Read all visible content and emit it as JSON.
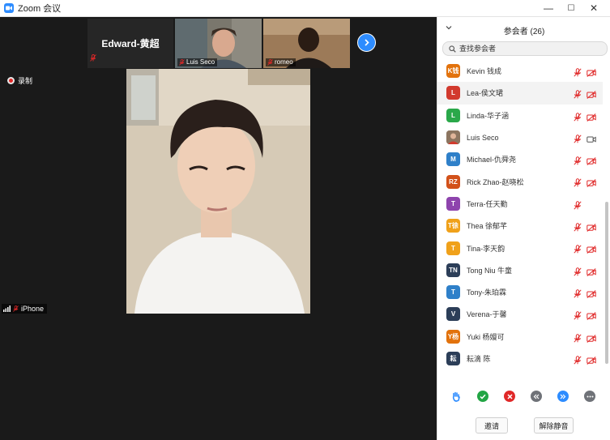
{
  "window": {
    "title": "Zoom 会议",
    "minimize": "—",
    "maximize": "☐",
    "close": "✕"
  },
  "meeting": {
    "tiles": [
      {
        "name": "Edward-黄超",
        "style": "name-only"
      },
      {
        "name": "Luis Seco"
      },
      {
        "name": "romeo"
      }
    ],
    "recording_label": "录制",
    "active_speaker": "iPhone"
  },
  "panel": {
    "title": "参会者 (26)",
    "search_placeholder": "查找参会者",
    "participants": [
      {
        "initials": "K钱",
        "name": "Kevin 钱成",
        "color": "#e2720c",
        "mic": "muted",
        "video": "off"
      },
      {
        "initials": "L",
        "name": "Lea-侯文珺",
        "color": "#d23a2e",
        "mic": "muted",
        "video": "off"
      },
      {
        "initials": "L",
        "name": "Linda-华子涵",
        "color": "#2aa84a",
        "mic": "muted",
        "video": "off"
      },
      {
        "initials": "",
        "name": "Luis Seco",
        "color": "#8c7560",
        "mic": "muted",
        "video": "on"
      },
      {
        "initials": "M",
        "name": "Michael-仇舜尧",
        "color": "#2f80c9",
        "mic": "muted",
        "video": "off"
      },
      {
        "initials": "RZ",
        "name": "Rick Zhao-赵晓松",
        "color": "#d2511a",
        "mic": "muted",
        "video": "off"
      },
      {
        "initials": "T",
        "name": "Terra-任天勤",
        "color": "#8e44ad",
        "mic": "muted",
        "video": "none"
      },
      {
        "initials": "T徐",
        "name": "Thea 徐郁芊",
        "color": "#f0a11a",
        "mic": "muted",
        "video": "off"
      },
      {
        "initials": "T",
        "name": "Tina-李天韵",
        "color": "#f0a11a",
        "mic": "muted",
        "video": "off"
      },
      {
        "initials": "TN",
        "name": "Tong Niu 牛童",
        "color": "#2c3e58",
        "mic": "muted",
        "video": "off"
      },
      {
        "initials": "T",
        "name": "Tony-朱珀霖",
        "color": "#2f80c9",
        "mic": "muted",
        "video": "off"
      },
      {
        "initials": "V",
        "name": "Verena-于馨",
        "color": "#2c3e58",
        "mic": "muted",
        "video": "off"
      },
      {
        "initials": "Y杨",
        "name": "Yuki 杨嫚可",
        "color": "#e2720c",
        "mic": "muted",
        "video": "off"
      },
      {
        "initials": "耘",
        "name": "耘滴 陈",
        "color": "#2c3e58",
        "mic": "muted",
        "video": "off"
      }
    ],
    "reaction_icons": [
      "raise-hand-icon",
      "yes-icon",
      "no-icon",
      "slower-icon",
      "faster-icon",
      "more-icon"
    ],
    "invite_label": "邀请",
    "unmute_all_label": "解除静音"
  },
  "colors": {
    "accent": "#2d8cff",
    "muted_red": "#e02828",
    "panel_bg": "#ffffff",
    "meeting_bg": "#1a1a1a"
  }
}
